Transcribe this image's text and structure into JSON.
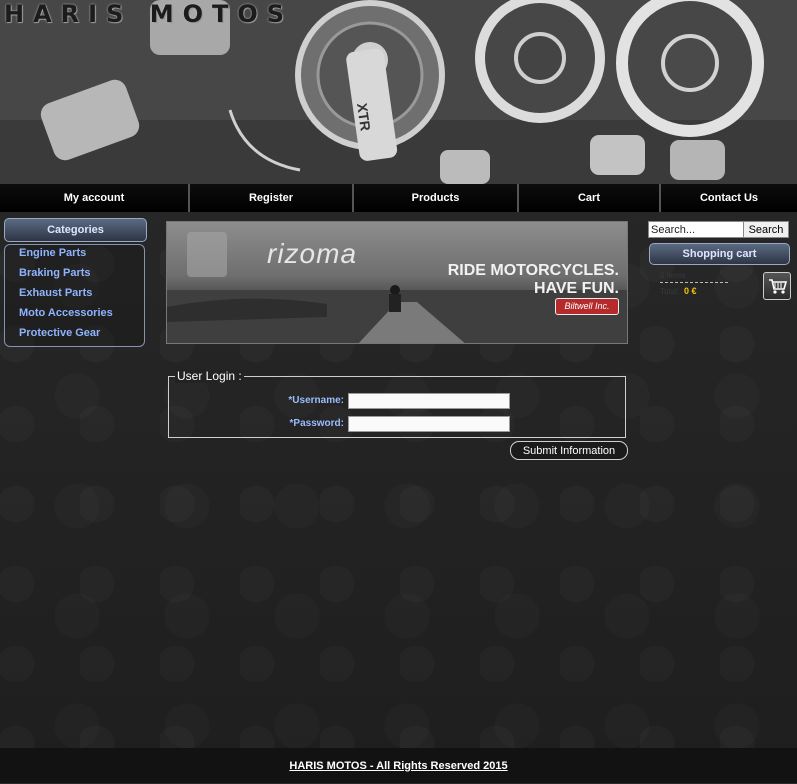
{
  "header": {
    "logo_text": "HARIS MOTOS",
    "hero_crank_text": "XTR"
  },
  "nav": {
    "items": [
      {
        "label": "My account"
      },
      {
        "label": "Register"
      },
      {
        "label": "Products"
      },
      {
        "label": "Cart"
      },
      {
        "label": "Contact Us"
      }
    ]
  },
  "categories": {
    "title": "Categories",
    "items": [
      {
        "label": "Engine Parts"
      },
      {
        "label": "Braking Parts"
      },
      {
        "label": "Exhaust Parts"
      },
      {
        "label": "Moto Accessories"
      },
      {
        "label": "Protective Gear"
      }
    ]
  },
  "promo": {
    "brand": "rizoma",
    "line1": "RIDE MOTORCYCLES.",
    "line2": "HAVE FUN.",
    "badge": "Biltwell Inc."
  },
  "login": {
    "legend": "User Login :",
    "username_label": "*Username:",
    "password_label": "*Password:",
    "username_value": "",
    "password_value": "",
    "submit_label": "Submit Information"
  },
  "search": {
    "value": "Search...",
    "button_label": "Search"
  },
  "cart": {
    "title": "Shopping cart",
    "items_text": "0 items",
    "total_label": "Total:",
    "total_value": "0 €",
    "icon": "shopping-cart-icon"
  },
  "footer": {
    "text": "HARIS MOTOS - All Rights Reserved 2015"
  },
  "colors": {
    "link": "#8fb4ff",
    "label": "#9bbcff",
    "total": "#f5c400",
    "panel_border": "#9aa8c2"
  }
}
